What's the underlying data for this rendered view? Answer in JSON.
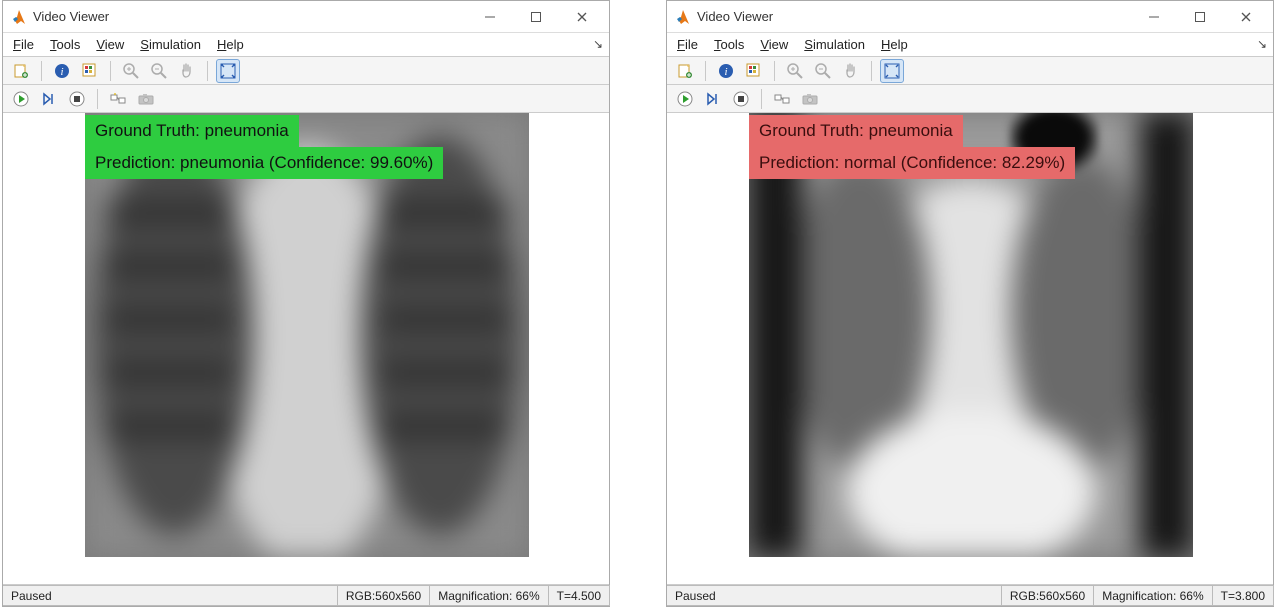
{
  "windows": [
    {
      "title": "Video Viewer",
      "menu": {
        "file": "File",
        "tools": "Tools",
        "view": "View",
        "simulation": "Simulation",
        "help": "Help"
      },
      "overlay": {
        "gt_label": "Ground Truth: pneumonia",
        "pred_label": "Prediction: pneumonia (Confidence: 99.60%)",
        "style": "green"
      },
      "status": {
        "state": "Paused",
        "rgb": "RGB:560x560",
        "mag": "Magnification: 66%",
        "time": "T=4.500"
      }
    },
    {
      "title": "Video Viewer",
      "menu": {
        "file": "File",
        "tools": "Tools",
        "view": "View",
        "simulation": "Simulation",
        "help": "Help"
      },
      "overlay": {
        "gt_label": "Ground Truth: pneumonia",
        "pred_label": "Prediction: normal (Confidence: 82.29%)",
        "style": "red"
      },
      "status": {
        "state": "Paused",
        "rgb": "RGB:560x560",
        "mag": "Magnification: 66%",
        "time": "T=3.800"
      }
    }
  ]
}
